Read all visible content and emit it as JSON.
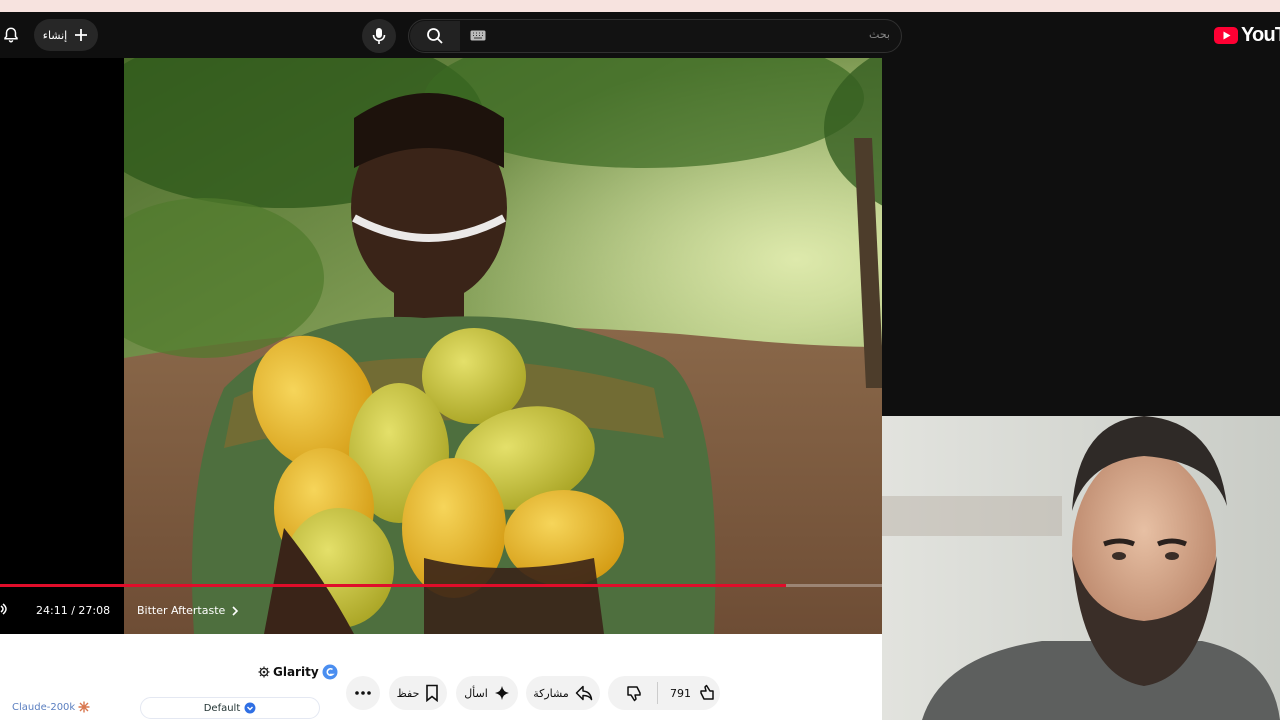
{
  "header": {
    "create_label": "إنشاء",
    "search_placeholder": "بحث",
    "logo_text": "YouTube"
  },
  "player": {
    "time_current": "24:11",
    "time_separator": "/",
    "time_total": "27:08",
    "progress_fraction": 0.891,
    "chapter_title": "Bitter Aftertaste"
  },
  "actions": {
    "like_count": "791",
    "share_label": "مشاركة",
    "ask_label": "اسأل",
    "save_label": "حفظ"
  },
  "extension": {
    "name": "Glarity",
    "model_label": "Claude-200k",
    "mode_label": "Default"
  },
  "colors": {
    "accent_red": "#e00d2a",
    "yt_red": "#ff0033"
  }
}
